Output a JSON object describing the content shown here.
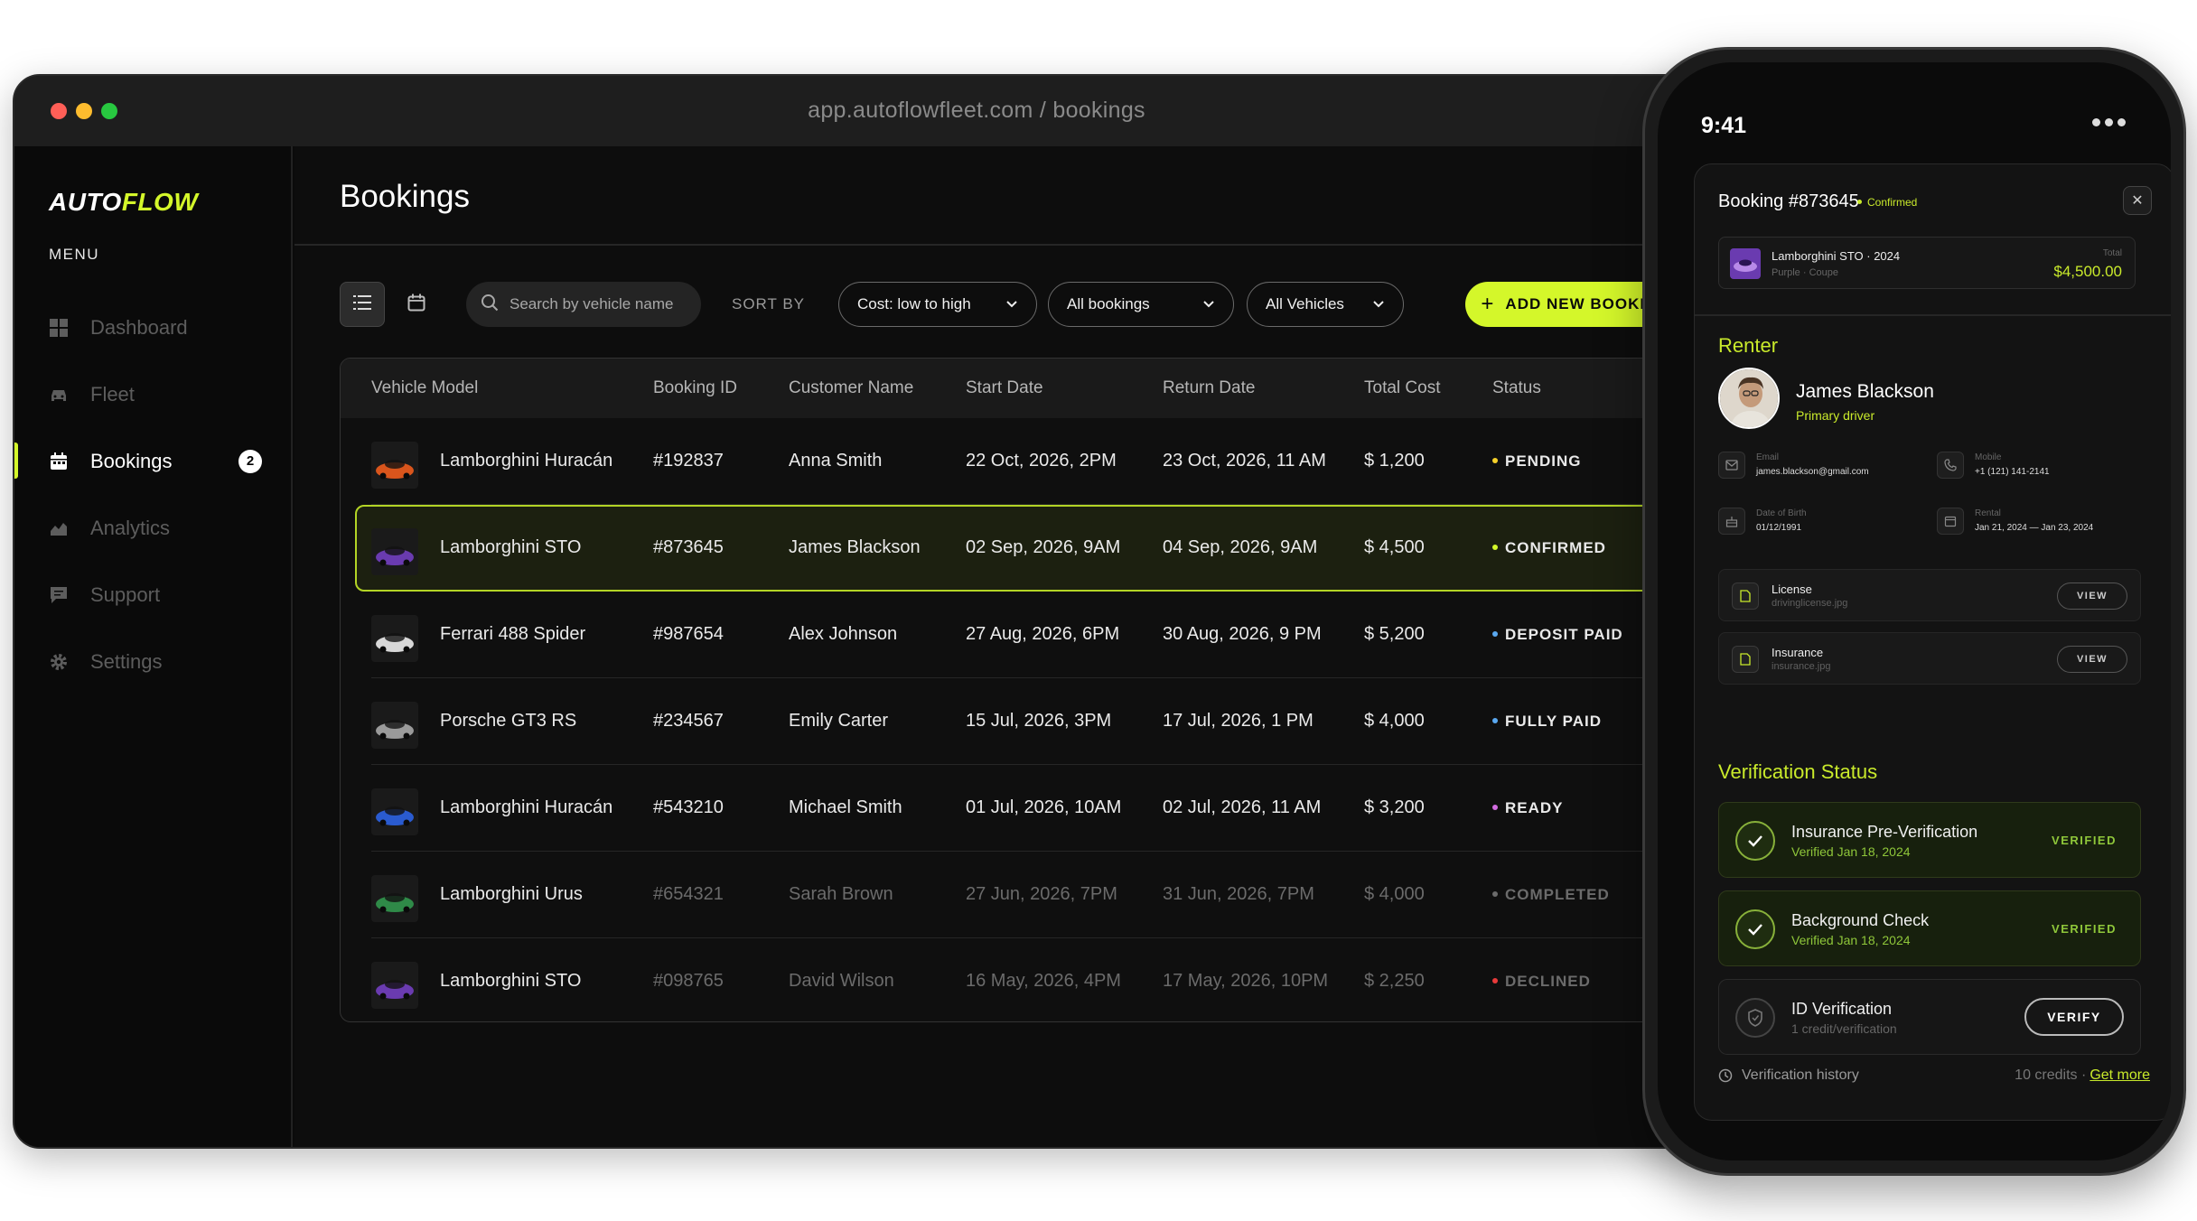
{
  "browser": {
    "url": "app.autoflowfleet.com / bookings"
  },
  "brand": {
    "logo_part1": "AUTO",
    "logo_part2": "FLOW",
    "accent": "#d4f72a"
  },
  "sidebar": {
    "menu_label": "MENU",
    "items": [
      {
        "label": "Dashboard",
        "icon": "grid-icon",
        "active": false
      },
      {
        "label": "Fleet",
        "icon": "car-icon",
        "active": false
      },
      {
        "label": "Bookings",
        "icon": "calendar-icon",
        "active": true,
        "badge": "2"
      },
      {
        "label": "Analytics",
        "icon": "chart-icon",
        "active": false
      },
      {
        "label": "Support",
        "icon": "chat-icon",
        "active": false
      },
      {
        "label": "Settings",
        "icon": "gear-icon",
        "active": false
      }
    ]
  },
  "page": {
    "title": "Bookings"
  },
  "toolbar": {
    "search_placeholder": "Search by vehicle name",
    "sort_label": "SORT BY",
    "sort_value": "Cost: low to high",
    "filter_bookings": "All bookings",
    "filter_vehicles": "All Vehicles",
    "add_button": "ADD NEW BOOKING"
  },
  "table": {
    "headers": [
      "Vehicle Model",
      "Booking ID",
      "Customer Name",
      "Start Date",
      "Return Date",
      "Total Cost",
      "Status"
    ],
    "rows": [
      {
        "vehicle": "Lamborghini Huracán",
        "id": "#192837",
        "customer": "Anna Smith",
        "start": "22 Oct, 2026, 2PM",
        "return": "23 Oct, 2026, 11 AM",
        "cost": "$ 1,200",
        "status": "PENDING",
        "status_color": "#f5d02a",
        "muted": false,
        "thumb": "#d9551c"
      },
      {
        "vehicle": "Lamborghini STO",
        "id": "#873645",
        "customer": "James Blackson",
        "start": "02 Sep, 2026, 9AM",
        "return": "04 Sep, 2026, 9AM",
        "cost": "$ 4,500",
        "status": "CONFIRMED",
        "status_color": "#d4f72a",
        "muted": false,
        "thumb": "#6a3bb0",
        "selected": true
      },
      {
        "vehicle": "Ferrari 488 Spider",
        "id": "#987654",
        "customer": "Alex Johnson",
        "start": "27 Aug, 2026, 6PM",
        "return": "30 Aug, 2026, 9 PM",
        "cost": "$ 5,200",
        "status": "DEPOSIT PAID",
        "status_color": "#5aa8f0",
        "muted": false,
        "thumb": "#d8d8d8"
      },
      {
        "vehicle": "Porsche GT3 RS",
        "id": "#234567",
        "customer": "Emily Carter",
        "start": "15 Jul, 2026, 3PM",
        "return": "17 Jul, 2026, 1 PM",
        "cost": "$ 4,000",
        "status": "FULLY PAID",
        "status_color": "#5aa8f0",
        "muted": false,
        "thumb": "#9a9a9a"
      },
      {
        "vehicle": "Lamborghini Huracán",
        "id": "#543210",
        "customer": "Michael Smith",
        "start": "01 Jul, 2026, 10AM",
        "return": "02 Jul, 2026, 11 AM",
        "cost": "$ 3,200",
        "status": "READY",
        "status_color": "#d26ce0",
        "muted": false,
        "thumb": "#2a5bd0"
      },
      {
        "vehicle": "Lamborghini Urus",
        "id": "#654321",
        "customer": "Sarah Brown",
        "start": "27 Jun, 2026, 7PM",
        "return": "31 Jun, 2026, 7PM",
        "cost": "$ 4,000",
        "status": "COMPLETED",
        "status_color": "#6b6b6b",
        "muted": true,
        "thumb": "#2f8a48"
      },
      {
        "vehicle": "Lamborghini STO",
        "id": "#098765",
        "customer": "David Wilson",
        "start": "16 May, 2026, 4PM",
        "return": "17 May, 2026, 10PM",
        "cost": "$ 2,250",
        "status": "DECLINED",
        "status_color": "#e83a3a",
        "muted": true,
        "thumb": "#6a3bb0"
      }
    ]
  },
  "phone": {
    "time": "9:41",
    "booking_title": "Booking #873645",
    "booking_status": "Confirmed",
    "vehicle_name": "Lamborghini STO · 2024",
    "vehicle_sub": "Purple · Coupe",
    "total_label": "Total",
    "total_value": "$4,500.00",
    "renter_title": "Renter",
    "renter_name": "James Blackson",
    "renter_role": "Primary driver",
    "email_label": "Email",
    "email_value": "james.blackson@gmail.com",
    "mobile_label": "Mobile",
    "mobile_value": "+1 (121) 141-2141",
    "dob_label": "Date of Birth",
    "dob_value": "01/12/1991",
    "rental_label": "Rental",
    "rental_value": "Jan 21, 2024 — Jan 23, 2024",
    "docs": [
      {
        "name": "License",
        "file": "drivinglicense.jpg",
        "button": "VIEW"
      },
      {
        "name": "Insurance",
        "file": "insurance.jpg",
        "button": "VIEW"
      }
    ],
    "verification_title": "Verification Status",
    "verifications": [
      {
        "title": "Insurance Pre-Verification",
        "sub": "Verified Jan 18, 2024",
        "state": "VERIFIED"
      },
      {
        "title": "Background Check",
        "sub": "Verified Jan 18, 2024",
        "state": "VERIFIED"
      },
      {
        "title": "ID Verification",
        "sub": "1 credit/verification",
        "state": "VERIFY"
      }
    ],
    "history_label": "Verification history",
    "credits_label": "10 credits ·",
    "get_more": "Get more"
  }
}
